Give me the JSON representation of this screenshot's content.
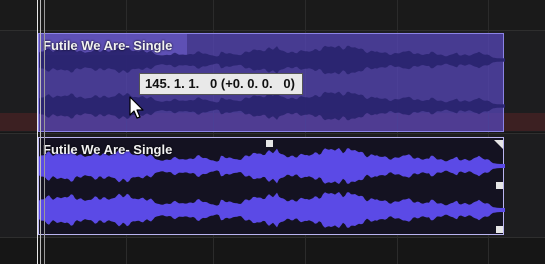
{
  "regions": [
    {
      "name": "Futile We Are- Single",
      "state": "selected"
    },
    {
      "name": "Futile We Are- Single",
      "state": "normal"
    }
  ],
  "tooltip": {
    "text": "145. 1. 1.   0 (+0. 0. 0.   0)"
  },
  "colors": {
    "background": "#161616",
    "region_fill_selected": "#5846be",
    "region_wave_selected": "#2a2470",
    "region_fill": "#141221",
    "region_wave": "#5b4ae6",
    "tooltip_bg": "#e9e9e9"
  },
  "icons": {
    "cursor": "arrow-pointer-icon",
    "fade_handle": "fade-handle-icon",
    "loop_handle": "loop-handle-icon",
    "resize_handle": "resize-handle-icon"
  }
}
